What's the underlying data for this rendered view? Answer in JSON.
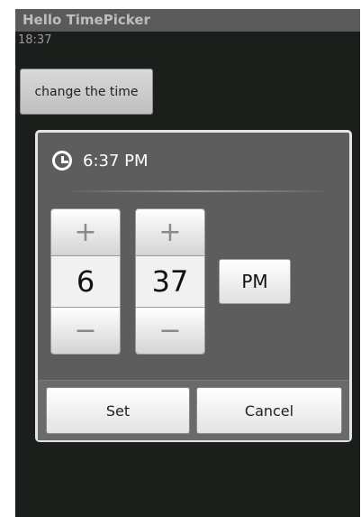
{
  "app": {
    "title": "Hello TimePicker"
  },
  "main": {
    "current_time": "18:37",
    "change_button_label": "change the time"
  },
  "dialog": {
    "title": "6:37 PM",
    "hour": {
      "increment": "+",
      "value": "6",
      "decrement": "−"
    },
    "minute": {
      "increment": "+",
      "value": "37",
      "decrement": "−"
    },
    "ampm": "PM",
    "buttons": {
      "set": "Set",
      "cancel": "Cancel"
    }
  },
  "icons": {
    "title_icon": "clock-icon"
  },
  "colors": {
    "dialog_bg": "#5d5d5d",
    "screen_bg": "#1b1f1c",
    "titlebar_bg": "#5a5a5a"
  }
}
